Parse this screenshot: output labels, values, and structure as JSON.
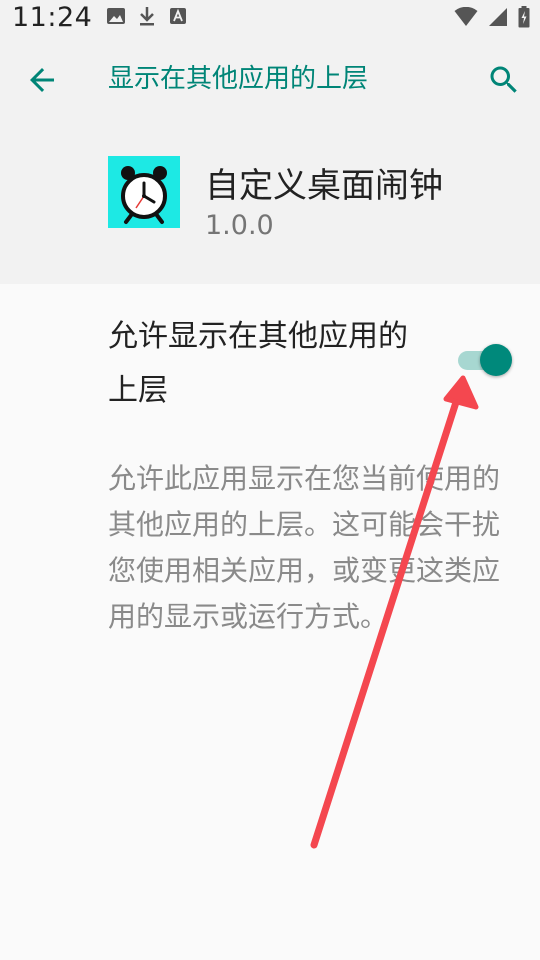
{
  "status_bar": {
    "time": "11:24",
    "left_icons": [
      "image-icon",
      "download-icon",
      "app-notification-icon"
    ],
    "right_icons": [
      "wifi-icon",
      "signal-icon",
      "battery-icon"
    ]
  },
  "app_bar": {
    "title": "显示在其他应用的上层",
    "back_icon": "arrow-back-icon",
    "search_icon": "search-icon"
  },
  "app_info": {
    "name": "自定义桌面闹钟",
    "version": "1.0.0",
    "icon": "alarm-clock-icon"
  },
  "setting": {
    "title": "允许显示在其他应用的上层",
    "enabled": true,
    "description": "允许此应用显示在您当前使用的其他应用的上层。这可能会干扰您使用相关应用，或变更这类应用的显示或运行方式。"
  },
  "colors": {
    "accent": "#008577",
    "toggle_thumb": "#00897b",
    "toggle_track": "#a7d7d1",
    "app_icon_bg": "#1de9e4",
    "annotation_arrow": "#f4474f"
  }
}
